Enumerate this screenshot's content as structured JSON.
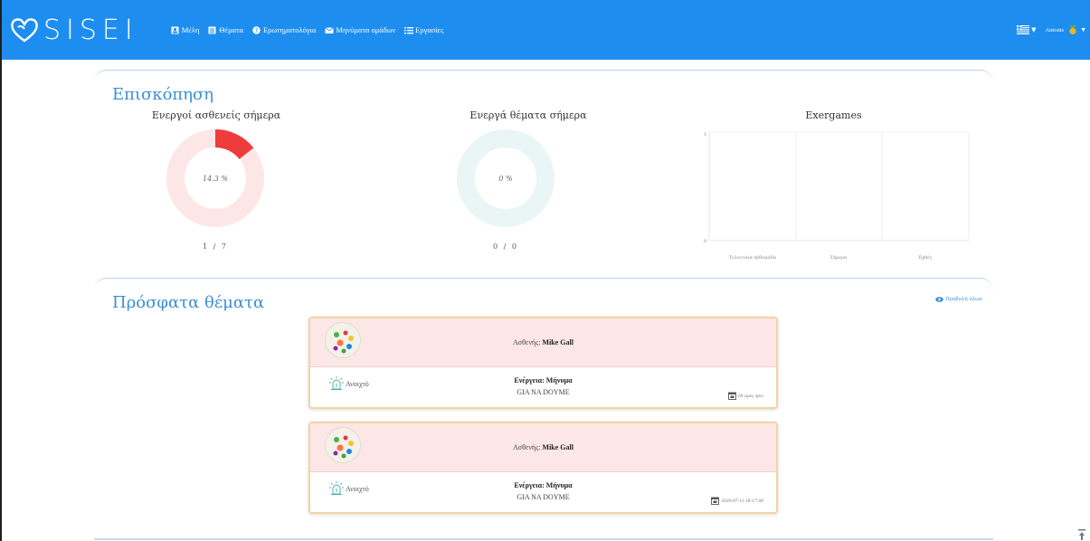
{
  "nav": {
    "brand": "SISEI",
    "links": [
      {
        "label": "Μέλη",
        "icon": "user-card-icon"
      },
      {
        "label": "Θέματα",
        "icon": "list-box-icon"
      },
      {
        "label": "Ερωτηματολόγια",
        "icon": "question-circle-icon"
      },
      {
        "label": "Μηνύματα ομάδων",
        "icon": "envelope-icon"
      },
      {
        "label": "Εργασίες",
        "icon": "tasks-icon"
      }
    ],
    "user": "Antonis"
  },
  "overview": {
    "title": "Επισκόπηση",
    "active_patients": {
      "title": "Ενεργοί ασθενείς σήμερα",
      "percent_label": "14.3 %",
      "percent": 14.3,
      "count": "1 / 7"
    },
    "active_topics": {
      "title": "Ενεργά θέματα σήμερα",
      "percent_label": "0 %",
      "percent": 0,
      "count": "0 / 0"
    },
    "exergames": {
      "title": "Exergames",
      "y_ticks": [
        "1",
        "0"
      ],
      "categories": [
        "Τελευταία εβδομάδα",
        "Σήμερα",
        "Εχθές"
      ]
    }
  },
  "recent": {
    "title": "Πρόσφατα θέματα",
    "view_all": "Προβολή όλων",
    "items": [
      {
        "patient_label": "Ασθενής:",
        "patient": "Mike Gall",
        "status": "Ανοιχτό",
        "action": "Ενέργεια: Μήνυμα",
        "message": "GIA NA DOYME",
        "time": "18 ώρες πριν"
      },
      {
        "patient_label": "Ασθενής:",
        "patient": "Mike Gall",
        "status": "Ανοιχτό",
        "action": "Ενέργεια: Μήνυμα",
        "message": "GIA NA DOYME",
        "time": "2020-07-11 18:17:00"
      }
    ]
  },
  "colors": {
    "navbar": "#1d8ef0",
    "accent": "#3b8fd8",
    "donut_fill": "#ee3b3b",
    "donut_bg": "#fde6e6",
    "donut_bg2": "#eaf6f6"
  }
}
